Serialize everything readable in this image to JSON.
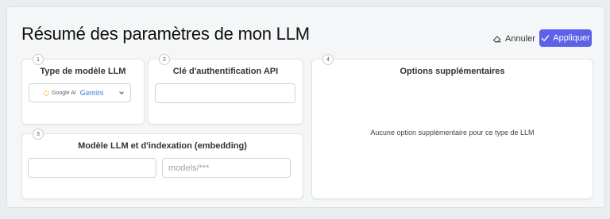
{
  "page": {
    "title": "Résumé des paramètres de mon LLM",
    "cancel_label": "Annuler",
    "apply_label": "Appliquer"
  },
  "cards": {
    "model_type": {
      "step": "1",
      "title": "Type de modèle LLM",
      "selected_provider": "Google AI",
      "selected_model": "Gemini"
    },
    "api_key": {
      "step": "2",
      "title": "Clé d'authentification API",
      "value": ""
    },
    "embedding": {
      "step": "3",
      "title": "Modèle LLM et d'indexation (embedding)",
      "llm_model_value": "",
      "embedding_placeholder": "models/***"
    },
    "extra_options": {
      "step": "4",
      "title": "Options supplémentaires",
      "empty_message": "Aucune option supplémentaire pour ce type de LLM"
    }
  },
  "icons": {
    "cancel": "eraser-icon",
    "apply": "check-icon",
    "dropdown": "chevron-down-icon"
  },
  "colors": {
    "primary": "#5b62e8",
    "background": "#e9edf0",
    "panel": "#f4f6f7"
  }
}
